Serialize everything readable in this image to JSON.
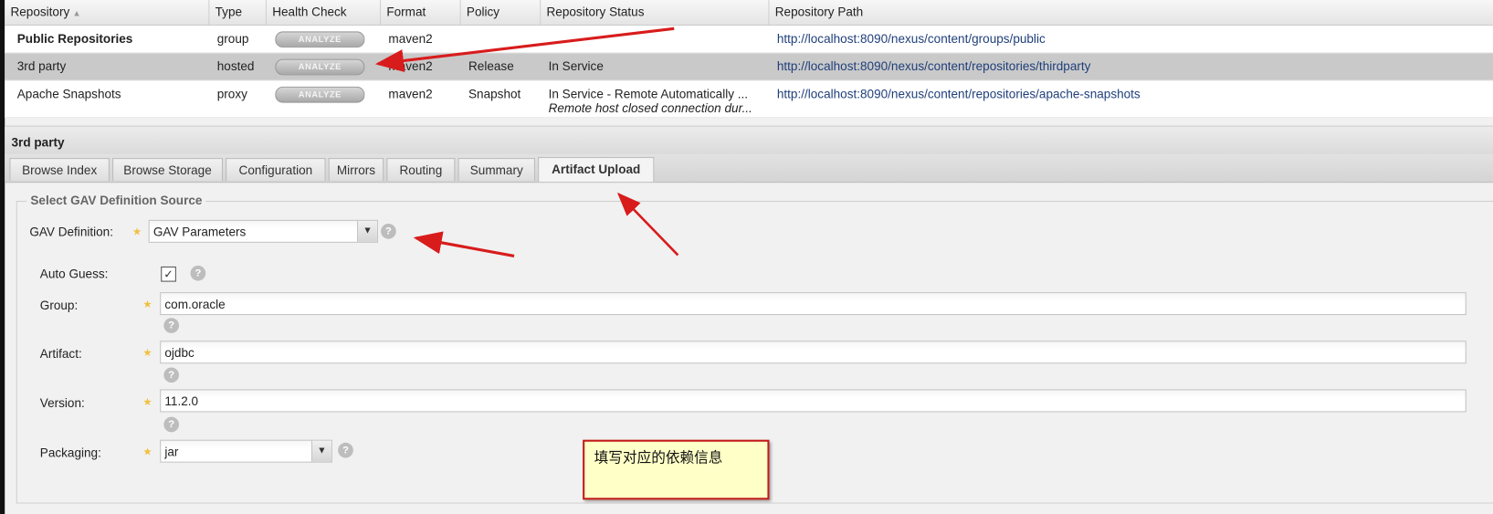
{
  "grid": {
    "columns": [
      "Repository",
      "Type",
      "Health Check",
      "Format",
      "Policy",
      "Repository Status",
      "Repository Path"
    ],
    "sort_icon": "sort-ascending-icon",
    "rows": [
      {
        "name": "Public Repositories",
        "type": "group",
        "health": "ANALYZE",
        "format": "maven2",
        "policy": "",
        "status": "",
        "status2": "",
        "path": "http://localhost:8090/nexus/content/groups/public"
      },
      {
        "name": "3rd party",
        "type": "hosted",
        "health": "ANALYZE",
        "format": "maven2",
        "policy": "Release",
        "status": "In Service",
        "status2": "",
        "path": "http://localhost:8090/nexus/content/repositories/thirdparty"
      },
      {
        "name": "Apache Snapshots",
        "type": "proxy",
        "health": "ANALYZE",
        "format": "maven2",
        "policy": "Snapshot",
        "status": "In Service - Remote Automatically ...",
        "status2": "Remote host closed connection dur...",
        "path": "http://localhost:8090/nexus/content/repositories/apache-snapshots"
      }
    ]
  },
  "panel": {
    "title": "3rd party",
    "tabs": [
      "Browse Index",
      "Browse Storage",
      "Configuration",
      "Mirrors",
      "Routing",
      "Summary",
      "Artifact Upload"
    ],
    "active_tab": "Artifact Upload"
  },
  "form": {
    "legend": "Select GAV Definition Source",
    "gav_label": "GAV Definition:",
    "gav_value": "GAV Parameters",
    "auto_guess_label": "Auto Guess:",
    "auto_guess_checked": true,
    "group_label": "Group:",
    "group_value": "com.oracle",
    "artifact_label": "Artifact:",
    "artifact_value": "ojdbc",
    "version_label": "Version:",
    "version_value": "11.2.0",
    "packaging_label": "Packaging:",
    "packaging_value": "jar",
    "help_glyph": "?",
    "required_glyph": "★",
    "dropdown_glyph": "⌄"
  },
  "annotation": {
    "note": "填写对应的依赖信息",
    "arrow_color": "#d81c1c"
  },
  "colors": {
    "link": "#1f3f7a",
    "selected_row": "#c9c9c9",
    "note_bg": "#ffffc8"
  }
}
